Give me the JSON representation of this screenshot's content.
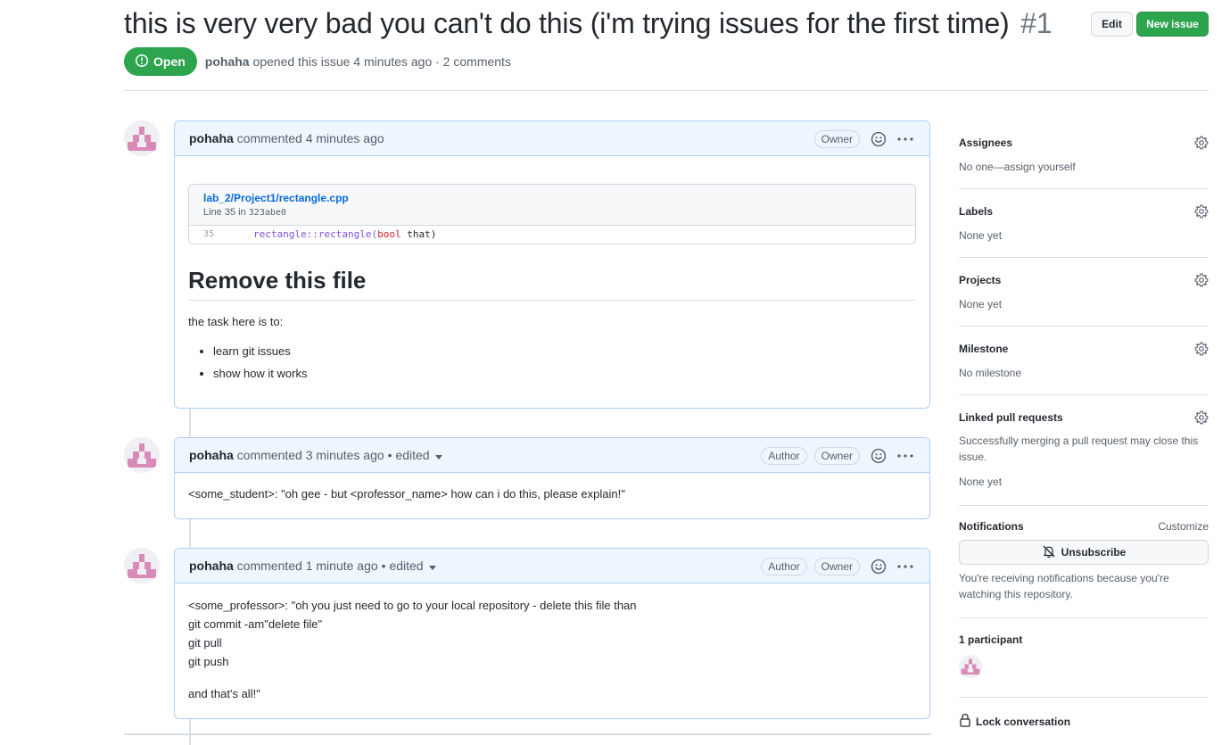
{
  "header": {
    "title": "this is very very bad you can't do this (i'm trying issues for the first time)",
    "number": "#1",
    "edit_label": "Edit",
    "new_issue_label": "New issue",
    "state_label": "Open",
    "author": "pohaha",
    "meta_rest": "opened this issue 4 minutes ago · 2 comments"
  },
  "comments": [
    {
      "author": "pohaha",
      "action": "commented 4 minutes ago",
      "owner_label": "Owner",
      "embed": {
        "path": "lab_2/Project1/rectangle.cpp",
        "line_prefix": "Line 35 in",
        "commit": "323abe0",
        "line_number": "35",
        "code_fn": "rectangle::rectangle(",
        "code_kw": "bool",
        "code_rest": " that)"
      },
      "heading": "Remove this file",
      "paragraph": "the task here is to:",
      "bullets": [
        "learn git issues",
        "show how it works"
      ]
    },
    {
      "author": "pohaha",
      "action": "commented 3 minutes ago",
      "edited_label": "• edited",
      "author_label": "Author",
      "owner_label": "Owner",
      "body": "<some_student>: \"oh gee - but <professor_name> how can i do this, please explain!\""
    },
    {
      "author": "pohaha",
      "action": "commented 1 minute ago",
      "edited_label": "• edited",
      "author_label": "Author",
      "owner_label": "Owner",
      "lines": [
        "<some_professor>: \"oh you just need to go to your local repository - delete this file than",
        "git commit -am\"delete file\"",
        "git pull",
        "git push"
      ],
      "closing": "and that's all!\""
    }
  ],
  "sidebar": {
    "assignees": {
      "title": "Assignees",
      "value": "No one—assign yourself"
    },
    "labels": {
      "title": "Labels",
      "value": "None yet"
    },
    "projects": {
      "title": "Projects",
      "value": "None yet"
    },
    "milestone": {
      "title": "Milestone",
      "value": "No milestone"
    },
    "linked_prs": {
      "title": "Linked pull requests",
      "desc": "Successfully merging a pull request may close this issue.",
      "value": "None yet"
    },
    "notifications": {
      "title": "Notifications",
      "customize": "Customize",
      "unsubscribe": "Unsubscribe",
      "desc": "You're receiving notifications because you're watching this repository."
    },
    "participants": {
      "title": "1 participant"
    },
    "lock_label": "Lock conversation"
  },
  "colors": {
    "accent_green": "#2da44e",
    "link_blue": "#0969da",
    "comment_border": "#afcef7",
    "comment_header_bg": "#eef6ff"
  }
}
